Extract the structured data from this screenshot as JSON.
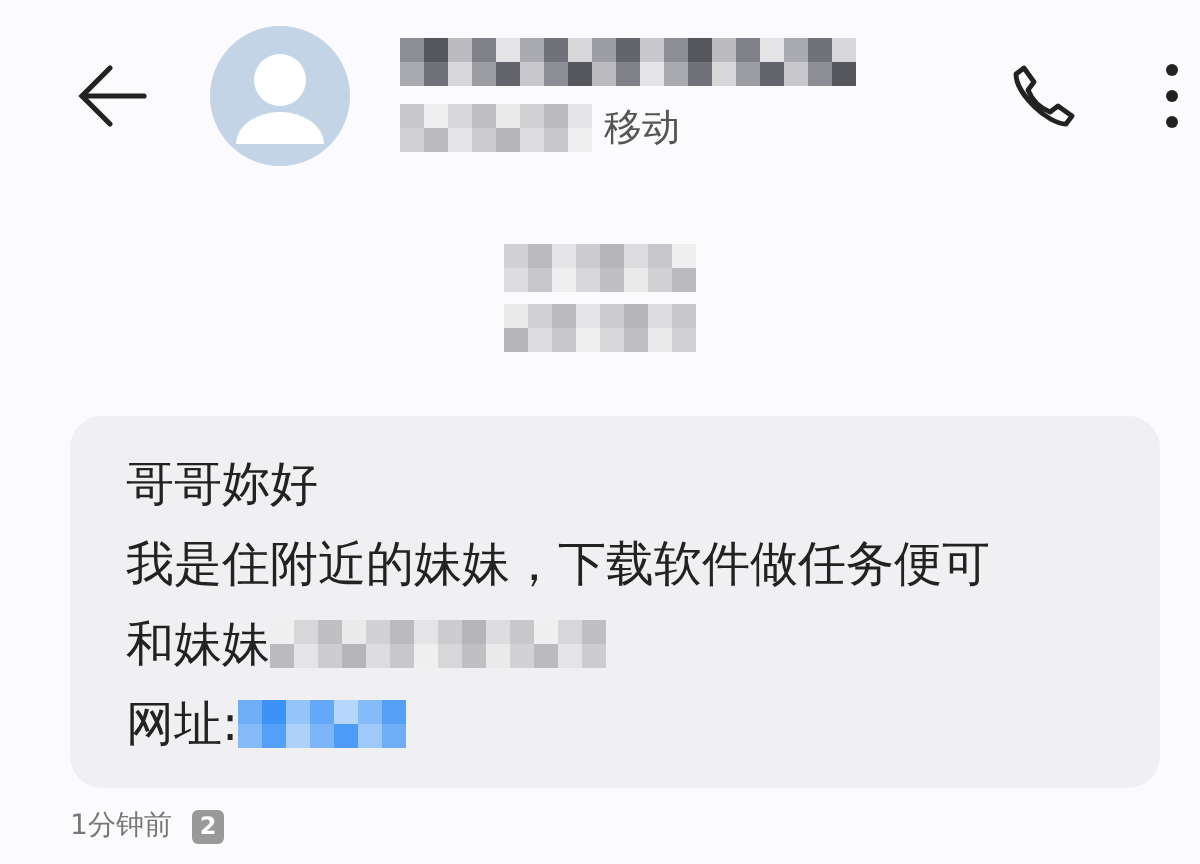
{
  "header": {
    "carrier": "移动"
  },
  "message": {
    "lines": [
      {
        "text": "哥哥妳好",
        "blurred_tail": false
      },
      {
        "text": "我是住附近的妹妹，下载软件做任务便可",
        "blurred_tail": false
      },
      {
        "text": "和妹妹",
        "blurred_tail": true
      },
      {
        "text": "网址:",
        "blurred_tail": true,
        "kind": "link"
      }
    ],
    "time": "1分钟前",
    "sim_slot": "2"
  }
}
